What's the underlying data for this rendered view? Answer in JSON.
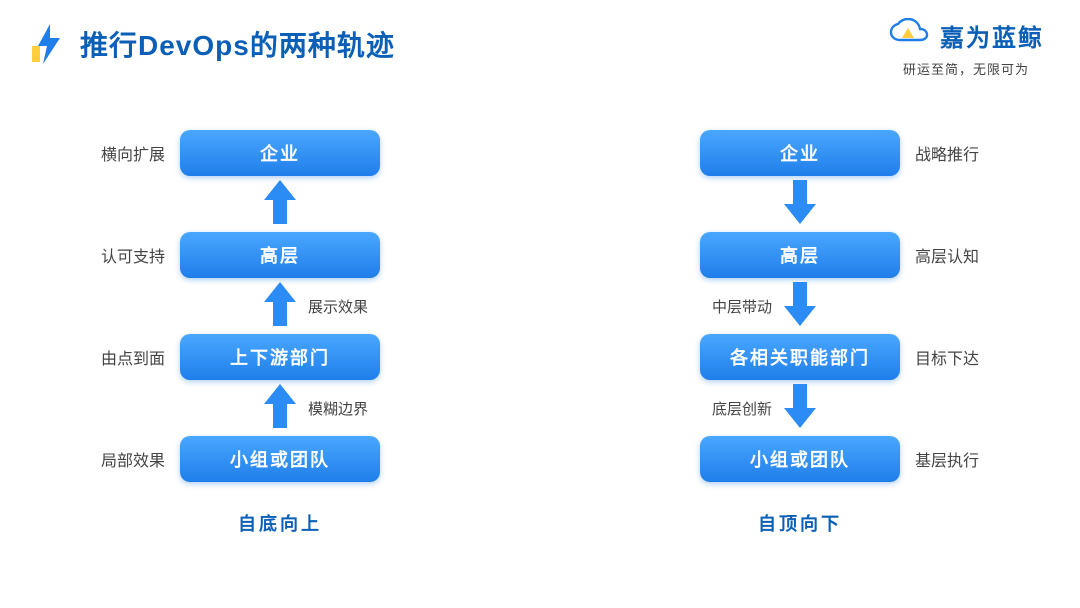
{
  "title": "推行DevOps的两种轨迹",
  "brand": {
    "name": "嘉为蓝鲸",
    "tagline": "研运至简，无限可为"
  },
  "left": {
    "subtitle": "自底向上",
    "levels": [
      {
        "node": "企业",
        "side": "横向扩展"
      },
      {
        "node": "高层",
        "side": "认可支持"
      },
      {
        "node": "上下游部门",
        "side": "由点到面"
      },
      {
        "node": "小组或团队",
        "side": "局部效果"
      }
    ],
    "arrows": [
      {
        "label": ""
      },
      {
        "label": "展示效果"
      },
      {
        "label": "模糊边界"
      }
    ]
  },
  "right": {
    "subtitle": "自顶向下",
    "levels": [
      {
        "node": "企业",
        "side": "战略推行"
      },
      {
        "node": "高层",
        "side": "高层认知"
      },
      {
        "node": "各相关职能部门",
        "side": "目标下达"
      },
      {
        "node": "小组或团队",
        "side": "基层执行"
      }
    ],
    "arrows": [
      {
        "label": ""
      },
      {
        "label": "中层带动"
      },
      {
        "label": "底层创新"
      }
    ]
  }
}
